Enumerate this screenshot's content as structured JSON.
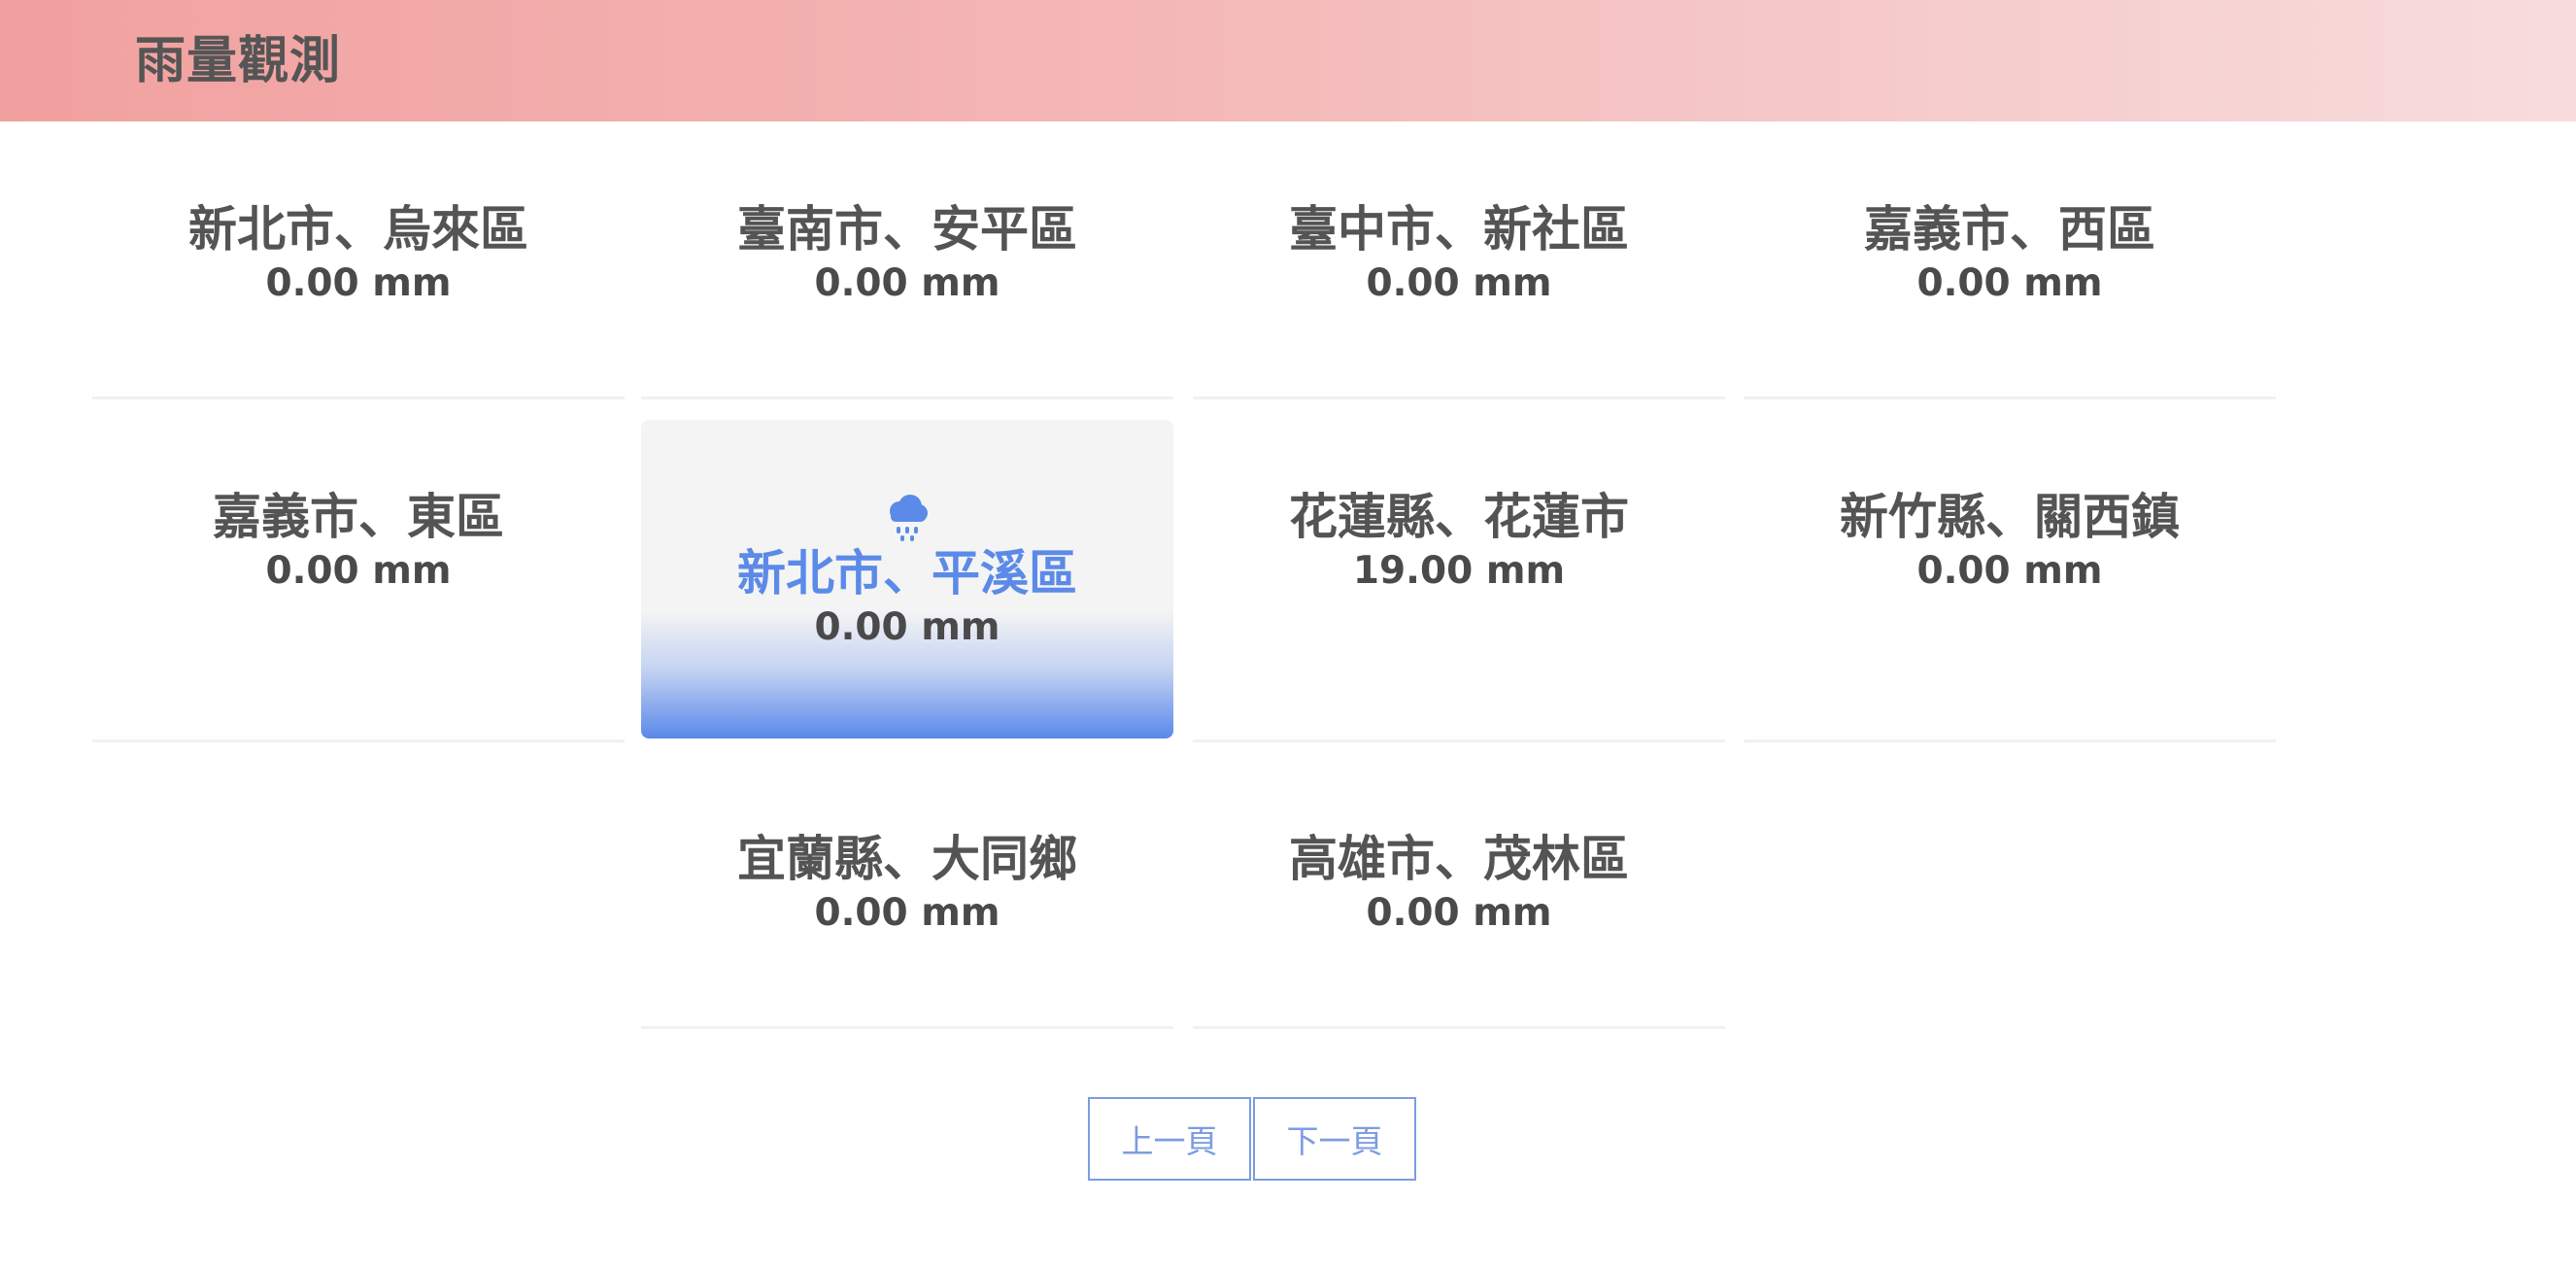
{
  "header": {
    "title": "雨量觀測"
  },
  "stations": [
    {
      "name": "新北市、烏來區",
      "rainfall": "0.00 mm"
    },
    {
      "name": "臺南市、安平區",
      "rainfall": "0.00 mm"
    },
    {
      "name": "臺中市、新社區",
      "rainfall": "0.00 mm"
    },
    {
      "name": "嘉義市、西區",
      "rainfall": "0.00 mm"
    },
    {
      "name": "嘉義市、東區",
      "rainfall": "0.00 mm"
    },
    {
      "name": "新北市、平溪區",
      "rainfall": "0.00 mm",
      "selected": true,
      "icon": "rain-cloud-icon"
    },
    {
      "name": "花蓮縣、花蓮市",
      "rainfall": "19.00 mm"
    },
    {
      "name": "新竹縣、關西鎮",
      "rainfall": "0.00 mm"
    },
    {
      "name": "宜蘭縣、大同鄉",
      "rainfall": "0.00 mm"
    },
    {
      "name": "高雄市、茂林區",
      "rainfall": "0.00 mm"
    }
  ],
  "pagination": {
    "prev_label": "上一頁",
    "next_label": "下一頁"
  },
  "colors": {
    "header_gradient_start": "#f1a19f",
    "header_gradient_end": "#f8dcdc",
    "accent_blue": "#5b8ae8",
    "text_dark": "#545454",
    "button_border": "#7d9ce2"
  }
}
